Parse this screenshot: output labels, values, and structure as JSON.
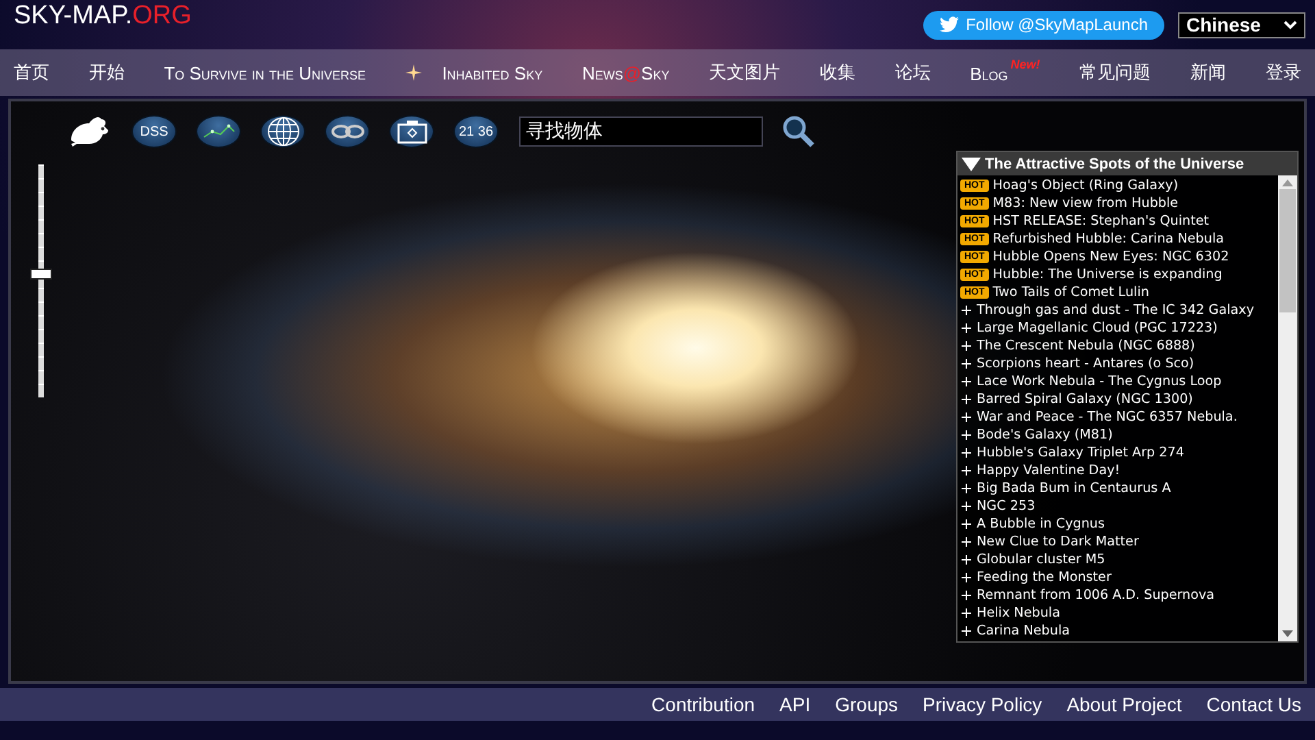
{
  "logo": {
    "main": "SKY-MAP.",
    "accent": "ORG"
  },
  "follow_button": "Follow @SkyMapLaunch",
  "language": {
    "value": "Chinese"
  },
  "nav": [
    {
      "parts": [
        {
          "text": "首页",
          "accent": false
        }
      ],
      "kind": "plain"
    },
    {
      "parts": [
        {
          "text": "开始",
          "accent": false
        }
      ],
      "kind": "plain"
    },
    {
      "parts": [
        {
          "text": "To Survive in the Universe",
          "accent": false
        }
      ],
      "kind": "plain"
    },
    {
      "parts": [
        {
          "text": "Inhabited Sky",
          "accent": false
        }
      ],
      "kind": "star"
    },
    {
      "parts": [
        {
          "text": "News",
          "accent": false
        },
        {
          "text": "@",
          "accent": true
        },
        {
          "text": "Sky",
          "accent": false
        }
      ],
      "kind": "plain"
    },
    {
      "parts": [
        {
          "text": "天文图片",
          "accent": false
        }
      ],
      "kind": "plain"
    },
    {
      "parts": [
        {
          "text": "收集",
          "accent": false
        }
      ],
      "kind": "plain"
    },
    {
      "parts": [
        {
          "text": "论坛",
          "accent": false
        }
      ],
      "kind": "plain"
    },
    {
      "parts": [
        {
          "text": "Blog",
          "accent": false
        }
      ],
      "kind": "plain",
      "badge": "New!"
    },
    {
      "parts": [
        {
          "text": "常见问题",
          "accent": false
        }
      ],
      "kind": "plain"
    },
    {
      "parts": [
        {
          "text": "新闻",
          "accent": false
        }
      ],
      "kind": "plain"
    },
    {
      "parts": [
        {
          "text": "登录",
          "accent": false
        }
      ],
      "kind": "plain"
    }
  ],
  "toolbar": [
    {
      "kind": "mouse"
    },
    {
      "kind": "text",
      "label": "DSS"
    },
    {
      "kind": "constellation"
    },
    {
      "kind": "globe"
    },
    {
      "kind": "chain"
    },
    {
      "kind": "camera"
    },
    {
      "kind": "text",
      "label": "21 36"
    }
  ],
  "search": {
    "value": "寻找物体"
  },
  "zoom_slider": {
    "level": 0.53
  },
  "spots_panel": {
    "title": "The Attractive Spots of the Universe",
    "items": [
      {
        "kind": "hot",
        "badge": "HOT",
        "label": "Hoag's Object (Ring Galaxy)"
      },
      {
        "kind": "hot",
        "badge": "HOT",
        "label": "M83: New view from Hubble"
      },
      {
        "kind": "hot",
        "badge": "HOT",
        "label": "HST RELEASE: Stephan's Quintet"
      },
      {
        "kind": "hot",
        "badge": "HOT",
        "label": "Refurbished Hubble: Carina Nebula"
      },
      {
        "kind": "hot",
        "badge": "HOT",
        "label": "Hubble Opens New Eyes: NGC 6302"
      },
      {
        "kind": "hot",
        "badge": "HOT",
        "label": "Hubble: The Universe is expanding"
      },
      {
        "kind": "hot",
        "badge": "HOT",
        "label": "Two Tails of Comet Lulin"
      },
      {
        "kind": "plus",
        "label": "Through gas and dust - The IC 342 Galaxy"
      },
      {
        "kind": "plus",
        "label": "Large Magellanic Cloud (PGC 17223)"
      },
      {
        "kind": "plus",
        "label": "The Crescent Nebula (NGC 6888)"
      },
      {
        "kind": "plus",
        "label": "Scorpions heart - Antares (ο Sco)"
      },
      {
        "kind": "plus",
        "label": "Lace Work Nebula - The Cygnus Loop"
      },
      {
        "kind": "plus",
        "label": "Barred Spiral Galaxy (NGC 1300)"
      },
      {
        "kind": "plus",
        "label": "War and Peace - The NGC 6357 Nebula."
      },
      {
        "kind": "plus",
        "label": "Bode's Galaxy (M81)"
      },
      {
        "kind": "plus",
        "label": "Hubble's Galaxy Triplet Arp 274"
      },
      {
        "kind": "plus",
        "label": "Happy Valentine Day!"
      },
      {
        "kind": "plus",
        "label": "Big Bada Bum in Centaurus A"
      },
      {
        "kind": "plus",
        "label": "NGC 253"
      },
      {
        "kind": "plus",
        "label": "A Bubble in Cygnus"
      },
      {
        "kind": "plus",
        "label": "New Clue to Dark Matter"
      },
      {
        "kind": "plus",
        "label": "Globular cluster M5"
      },
      {
        "kind": "plus",
        "label": "Feeding the Monster"
      },
      {
        "kind": "plus",
        "label": "Remnant from 1006 A.D. Supernova"
      },
      {
        "kind": "plus",
        "label": "Helix Nebula"
      },
      {
        "kind": "plus",
        "label": "Carina Nebula"
      }
    ]
  },
  "footer": [
    "Contribution",
    "API",
    "Groups",
    "Privacy Policy",
    "About Project",
    "Contact Us"
  ]
}
